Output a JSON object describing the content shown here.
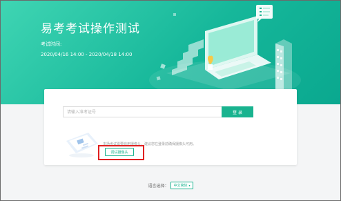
{
  "exam": {
    "title": "易考考试操作测试",
    "time_label": "考试时间:",
    "time_range": "2020/04/16 14:00 - 2020/04/18 14:00"
  },
  "login": {
    "id_placeholder": "请输入准考证号",
    "login_label": "登 录"
  },
  "camera": {
    "tip": "本场考试需要启用摄像头，建议您在登录前确保摄像头可用。",
    "test_button_label": "调试摄像头"
  },
  "language": {
    "label": "语言选择：",
    "selected": "中文简体"
  },
  "colors": {
    "accent": "#19b38f",
    "hero_start": "#3fd5b3",
    "hero_end": "#0aa88f",
    "highlight": "#e02020"
  },
  "icons": {
    "laptop": "laptop-illustration-icon",
    "chat": "chat-bubble-icon",
    "building": "building-icon",
    "plant": "plant-icon",
    "camera_card": "camera-card-icon",
    "caret": "chevron-down-icon"
  }
}
